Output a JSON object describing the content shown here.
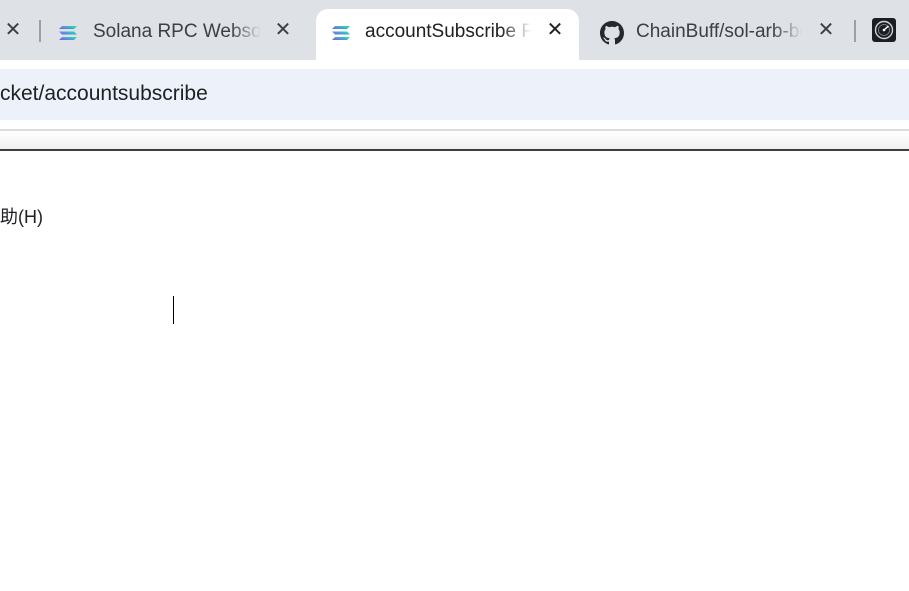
{
  "tabs": [
    {
      "title": "",
      "close_glyph": "✕",
      "icon": "close-icon"
    },
    {
      "title": "Solana RPC Websocket",
      "close_glyph": "✕",
      "icon": "solana-icon"
    },
    {
      "title": "accountSubscribe RPC",
      "close_glyph": "✕",
      "icon": "solana-icon",
      "active": true
    },
    {
      "title": "ChainBuff/sol-arb-bot",
      "close_glyph": "✕",
      "icon": "github-icon"
    },
    {
      "title": "",
      "icon": "speedometer-icon"
    }
  ],
  "address_bar": {
    "url": "cket/accountsubscribe"
  },
  "page": {
    "menu_item": "助(H)"
  },
  "colors": {
    "tabstrip_bg": "#dee1e6",
    "omnibox_bg": "#edf2fa",
    "solana_gradient": [
      "#00ffa3",
      "#9945ff"
    ]
  }
}
